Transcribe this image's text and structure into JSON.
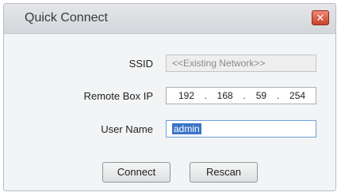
{
  "window": {
    "title": "Quick Connect"
  },
  "close": {
    "glyph": "✕"
  },
  "fields": {
    "ssid": {
      "label": "SSID",
      "value": "<<Existing Network>>"
    },
    "remote_ip": {
      "label": "Remote Box IP",
      "octets": [
        "192",
        "168",
        "59",
        "254"
      ],
      "separator": "."
    },
    "user_name": {
      "label": "User Name",
      "value": "admin"
    }
  },
  "buttons": {
    "connect": "Connect",
    "rescan": "Rescan"
  },
  "colors": {
    "close_button": "#c9412a",
    "selection": "#3b74c9"
  }
}
